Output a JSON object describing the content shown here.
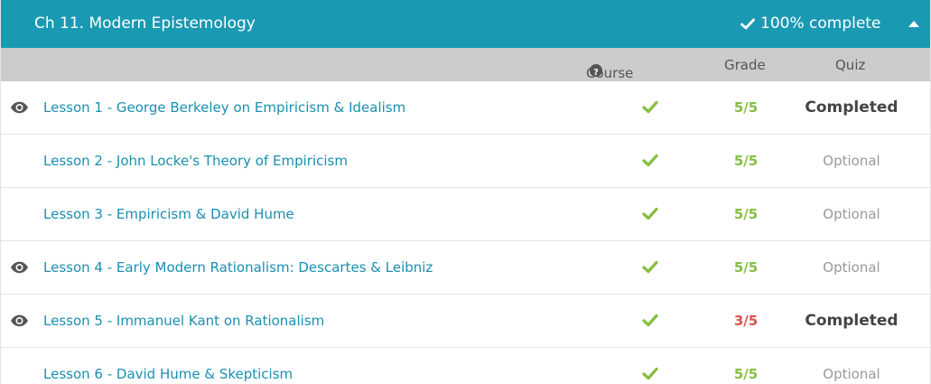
{
  "chapter": {
    "title": "Ch 11. Modern Epistemology",
    "status": "100% complete"
  },
  "columns": {
    "progress": "Course Progress",
    "grade": "Grade",
    "quiz": "Quiz"
  },
  "colors": {
    "header_bg": "#1a99b3",
    "link": "#1a8fb0",
    "check_green": "#85be3f",
    "grade_low": "#d9534f"
  },
  "lessons": [
    {
      "title": "Lesson 1 - George Berkeley on Empiricism & Idealism",
      "viewed": true,
      "progress_icon": "check-icon",
      "grade": "5/5",
      "grade_status": "good",
      "quiz": "Completed"
    },
    {
      "title": "Lesson 2 - John Locke's Theory of Empiricism",
      "viewed": false,
      "progress_icon": "check-icon",
      "grade": "5/5",
      "grade_status": "good",
      "quiz": "Optional"
    },
    {
      "title": "Lesson 3 - Empiricism & David Hume",
      "viewed": false,
      "progress_icon": "check-icon",
      "grade": "5/5",
      "grade_status": "good",
      "quiz": "Optional"
    },
    {
      "title": "Lesson 4 - Early Modern Rationalism: Descartes & Leibniz",
      "viewed": true,
      "progress_icon": "check-icon",
      "grade": "5/5",
      "grade_status": "good",
      "quiz": "Optional"
    },
    {
      "title": "Lesson 5 - Immanuel Kant on Rationalism",
      "viewed": true,
      "progress_icon": "check-icon",
      "grade": "3/5",
      "grade_status": "low",
      "quiz": "Completed"
    },
    {
      "title": "Lesson 6 - David Hume & Skepticism",
      "viewed": false,
      "progress_icon": "check-icon",
      "grade": "5/5",
      "grade_status": "good",
      "quiz": "Optional"
    }
  ]
}
